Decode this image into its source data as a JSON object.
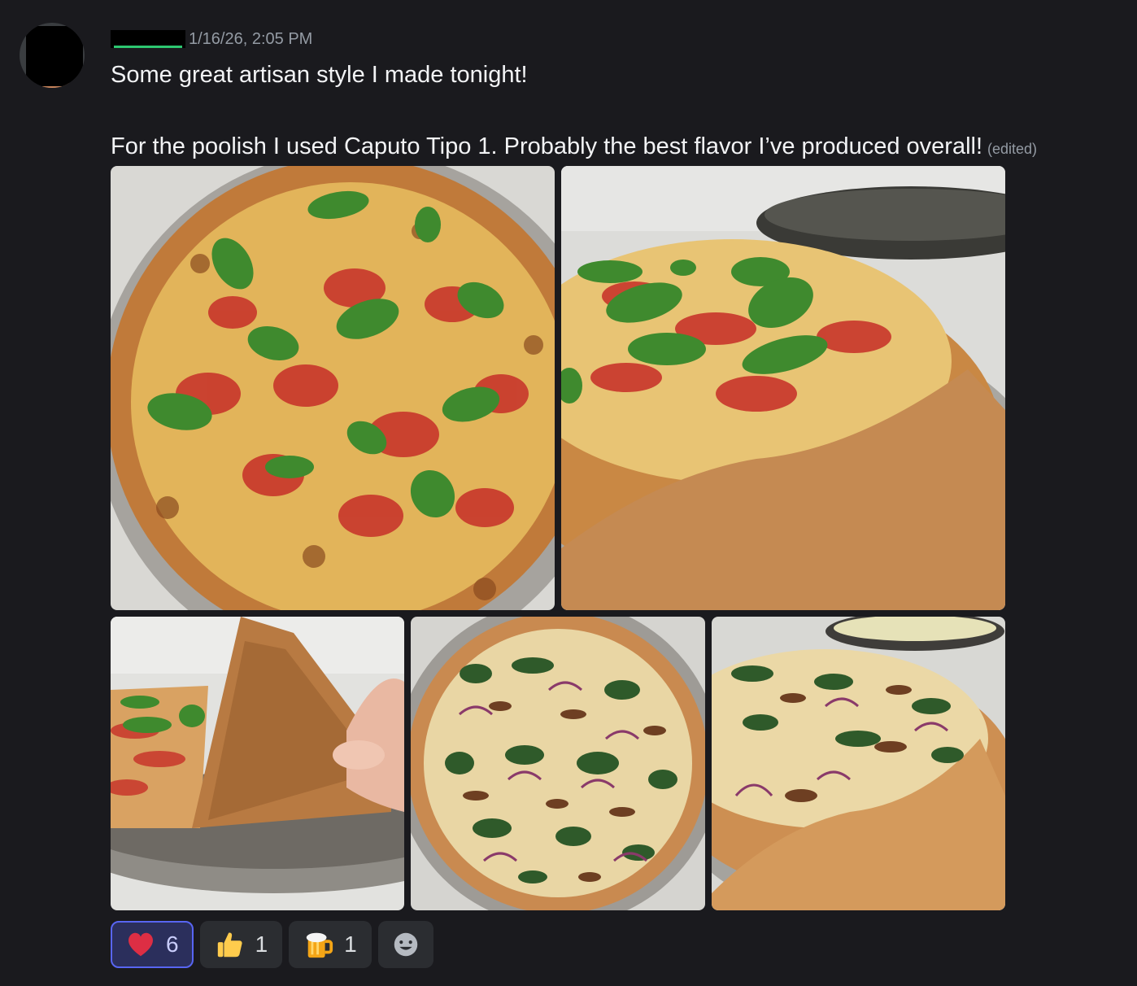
{
  "message": {
    "timestamp": "1/16/26, 2:05 PM",
    "lines": [
      "Some great artisan style I made tonight!",
      "For the poolish I used Caputo Tipo 1. Probably the best flavor I’ve produced overall!"
    ],
    "edited_label": "(edited)"
  },
  "attachments": [
    {
      "icon": "pizza-margherita-photo"
    },
    {
      "icon": "pizza-margherita-angle-photo"
    },
    {
      "icon": "pizza-slice-underside-photo"
    },
    {
      "icon": "pizza-mushroom-onion-photo"
    },
    {
      "icon": "pizza-mushroom-onion-angle-photo"
    }
  ],
  "reactions": [
    {
      "emoji": "heart",
      "count": "6",
      "active": true
    },
    {
      "emoji": "thumbs-up",
      "count": "1",
      "active": false
    },
    {
      "emoji": "beer-mug",
      "count": "1",
      "active": false
    }
  ],
  "colors": {
    "background": "#1a1a1e",
    "timestamp": "#949ba4",
    "active_reaction_border": "#5865f2",
    "username_accent": "#2dc770"
  }
}
